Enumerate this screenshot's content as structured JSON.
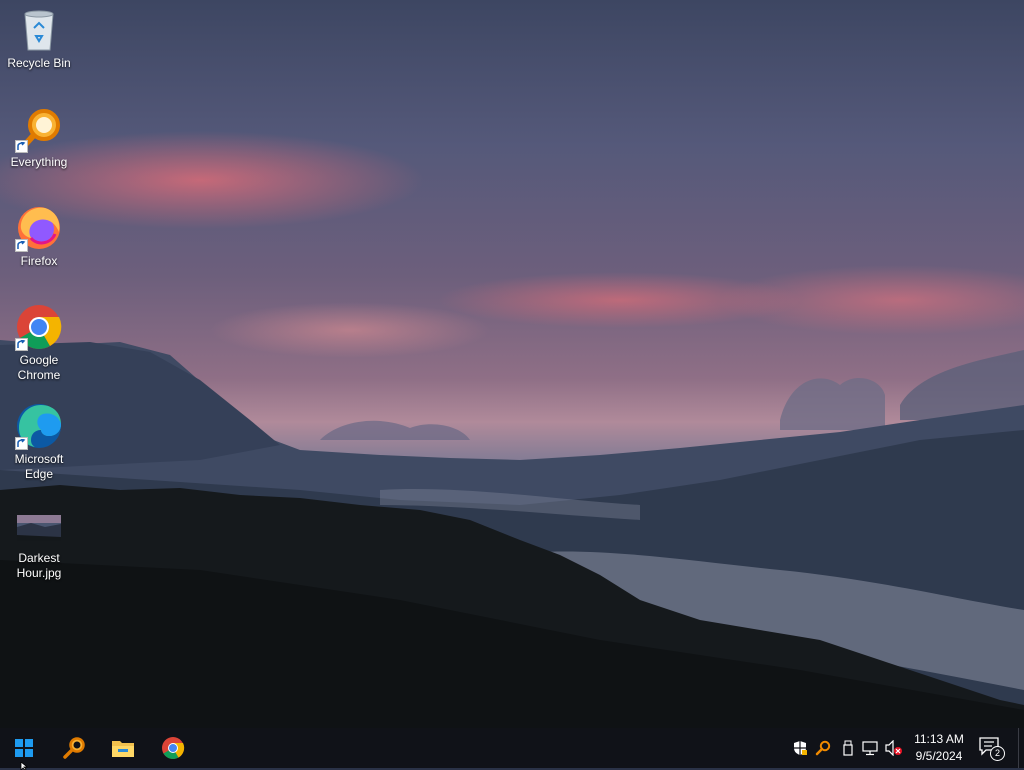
{
  "desktop": {
    "icons": [
      {
        "id": "recycle-bin",
        "label": "Recycle Bin",
        "icon": "recycle-bin-icon"
      },
      {
        "id": "everything",
        "label": "Everything",
        "icon": "everything-search-icon"
      },
      {
        "id": "firefox",
        "label": "Firefox",
        "icon": "firefox-icon"
      },
      {
        "id": "chrome",
        "label": "Google Chrome",
        "icon": "chrome-icon"
      },
      {
        "id": "edge",
        "label": "Microsoft Edge",
        "icon": "edge-icon"
      },
      {
        "id": "darkest-hour",
        "label": "Darkest Hour.jpg",
        "icon": "image-file-icon"
      }
    ]
  },
  "taskbar": {
    "pinned": [
      {
        "id": "start",
        "icon": "windows-start-icon"
      },
      {
        "id": "everything",
        "icon": "everything-search-icon"
      },
      {
        "id": "file-explorer",
        "icon": "folder-icon"
      },
      {
        "id": "chrome",
        "icon": "chrome-icon"
      }
    ],
    "tray": {
      "icons": [
        "security-shield-icon",
        "everything-tray-icon",
        "usb-drive-icon",
        "network-icon",
        "volume-muted-icon"
      ],
      "time": "11:13 AM",
      "date": "9/5/2024",
      "notification_count": "2"
    }
  },
  "colors": {
    "taskbar_bg": "#101218",
    "windows_blue": "#1e9bf0",
    "everything_orange": "#f08a00"
  }
}
